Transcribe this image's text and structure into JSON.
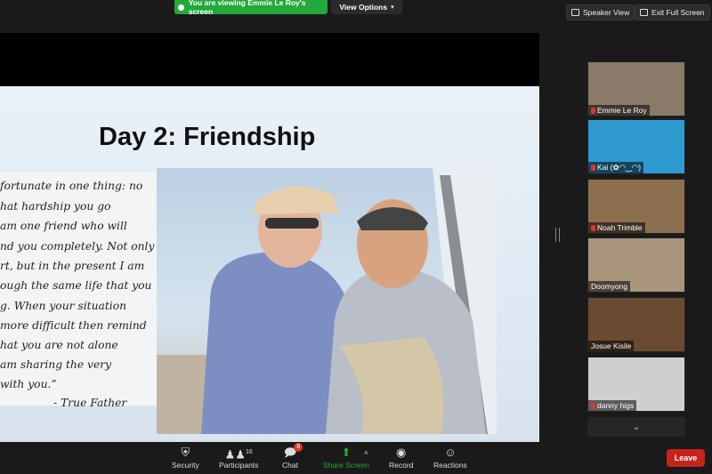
{
  "banner": {
    "text": "You are viewing Emmie Le Roy's screen",
    "view_options": "View Options"
  },
  "top_buttons": {
    "speaker_view": "Speaker View",
    "exit_full_screen": "Exit Full Screen"
  },
  "slide": {
    "title": "Day 2: Friendship",
    "quote_lines": [
      "fortunate in one thing: no",
      "hat hardship you go",
      "am one friend who will",
      "nd you completely. Not only",
      "rt, but in the present I am",
      "ough the same life that you",
      "g. When your situation",
      "more difficult then remind",
      "hat you are not alone",
      "am sharing the very",
      "with you.”"
    ],
    "attribution": "-    True Father"
  },
  "participants": [
    {
      "name": "Emmie Le Roy",
      "muted": true
    },
    {
      "name": "Kai (✿◠‿◠)",
      "muted": true
    },
    {
      "name": "Noah Trimble",
      "muted": true
    },
    {
      "name": "Doomyong",
      "muted": false
    },
    {
      "name": "Josue Kisile",
      "muted": false
    },
    {
      "name": "danny higs",
      "muted": true
    }
  ],
  "toolbar": {
    "security": "Security",
    "participants": "Participants",
    "participants_count": "16",
    "chat": "Chat",
    "chat_badge": "8",
    "share_screen": "Share Screen",
    "record": "Record",
    "reactions": "Reactions",
    "leave": "Leave"
  },
  "colors": {
    "share_green": "#23a83a",
    "leave_red": "#c8221d",
    "mute_red": "#e0342c"
  }
}
